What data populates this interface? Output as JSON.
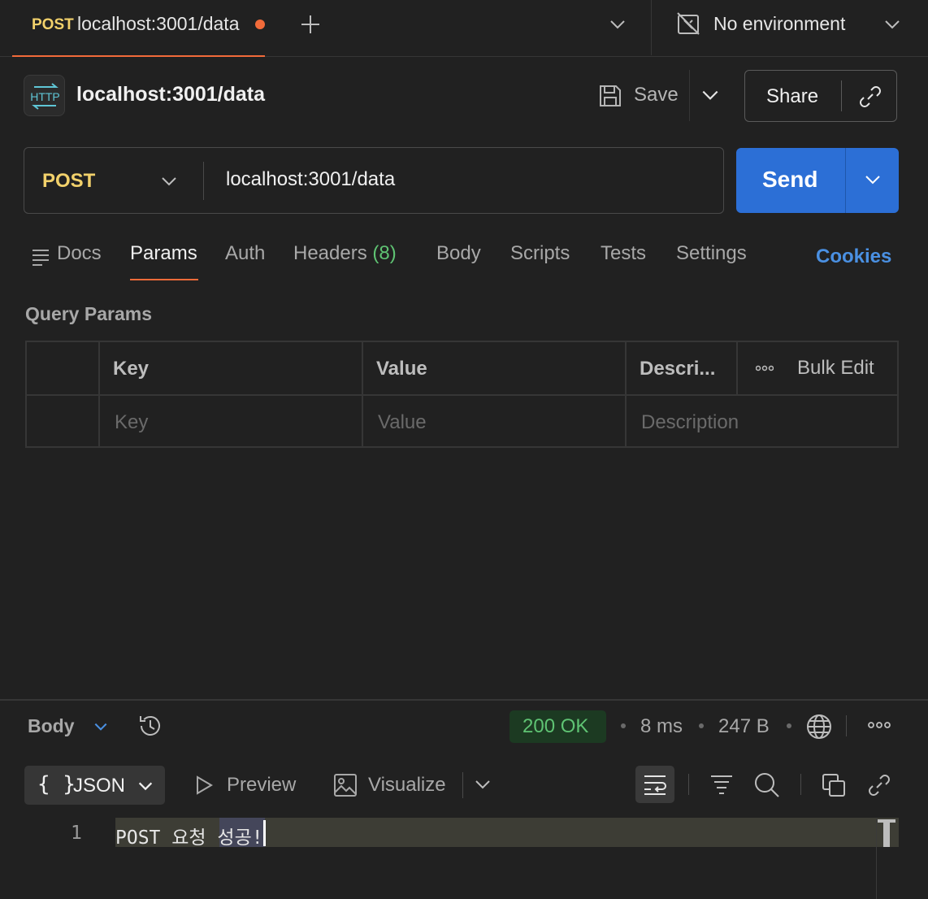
{
  "tab": {
    "method": "POST",
    "url": "localhost:3001/data"
  },
  "environment": {
    "label": "No environment"
  },
  "request": {
    "title": "localhost:3001/data",
    "save_label": "Save",
    "share_label": "Share",
    "method": "POST",
    "url": "localhost:3001/data",
    "send_label": "Send"
  },
  "request_tabs": {
    "docs": "Docs",
    "params": "Params",
    "auth": "Auth",
    "headers": "Headers",
    "headers_count": "(8)",
    "body": "Body",
    "scripts": "Scripts",
    "tests": "Tests",
    "settings": "Settings",
    "cookies": "Cookies"
  },
  "query_params": {
    "title": "Query Params",
    "columns": {
      "key": "Key",
      "value": "Value",
      "description": "Descri...",
      "bulk_edit": "Bulk Edit"
    },
    "placeholders": {
      "key": "Key",
      "value": "Value",
      "description": "Description"
    }
  },
  "response": {
    "body_label": "Body",
    "status": "200 OK",
    "time": "8 ms",
    "size": "247 B",
    "format_label": "JSON",
    "format_braces": "{ }",
    "preview_label": "Preview",
    "visualize_label": "Visualize",
    "line_number": "1",
    "body_text": "POST 요청 성공!"
  },
  "colors": {
    "accent_orange": "#f26b3a",
    "method_yellow": "#f2d16b",
    "send_blue": "#2c6fd6",
    "status_green": "#5fc373",
    "cookies_blue": "#4a90e2"
  }
}
